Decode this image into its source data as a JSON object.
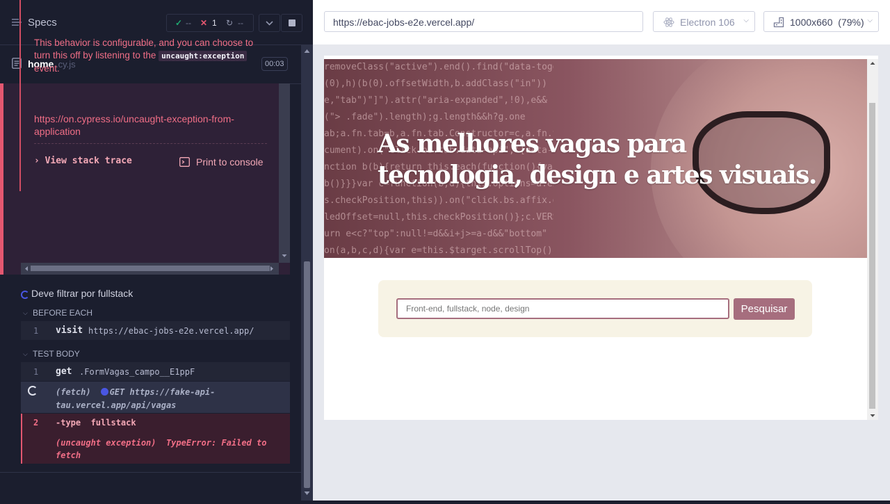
{
  "sidebar": {
    "specs_label": "Specs",
    "stats": {
      "pass_icon": "✓",
      "passed": "--",
      "fail_icon": "✕",
      "failed": "1",
      "pending_icon": "↻",
      "pending": "--"
    },
    "file": {
      "name": "home",
      "ext": ".cy.js",
      "duration": "00:03"
    },
    "error": {
      "text_before": "This behavior is configurable, and you can choose to turn this off by listening to the",
      "code": "uncaught:exception",
      "text_after": "event.",
      "link": "https://on.cypress.io/uncaught-exception-from-application",
      "stack_trace_label": "View stack trace",
      "print_console_label": "Print to console"
    },
    "test": {
      "title": "Deve filtrar por fullstack",
      "before_each_label": "BEFORE EACH",
      "before_each_cmds": [
        {
          "num": "1",
          "name": "visit",
          "msg": "https://ebac-jobs-e2e.vercel.app/"
        }
      ],
      "test_body_label": "TEST BODY",
      "body_cmds": [
        {
          "num": "1",
          "name": "get",
          "msg": ".FormVagas_campo__E1ppF"
        }
      ],
      "fetch": {
        "label": "(fetch)",
        "method": "GET",
        "url": "https://fake-api-tau.vercel.app/api/vagas"
      },
      "failed_cmd": {
        "num": "2",
        "name": "-type",
        "msg": "fullstack",
        "error_prefix": "(uncaught exception)",
        "error": "TypeError: Failed to fetch"
      }
    }
  },
  "browser": {
    "url": "https://ebac-jobs-e2e.vercel.app/",
    "browser_name": "Electron 106",
    "viewport": "1000x660",
    "viewport_display": "1000x660",
    "zoom": "(79%)"
  },
  "app": {
    "hero_title": "As melhores vagas para tecnologia, design e artes visuais.",
    "search_placeholder": "Front-end, fullstack, node, design",
    "search_button": "Pesquisar"
  },
  "colors": {
    "fail": "#e45770",
    "pass": "#1fa971",
    "accent": "#a66e7e",
    "spinner": "#4956e3"
  }
}
